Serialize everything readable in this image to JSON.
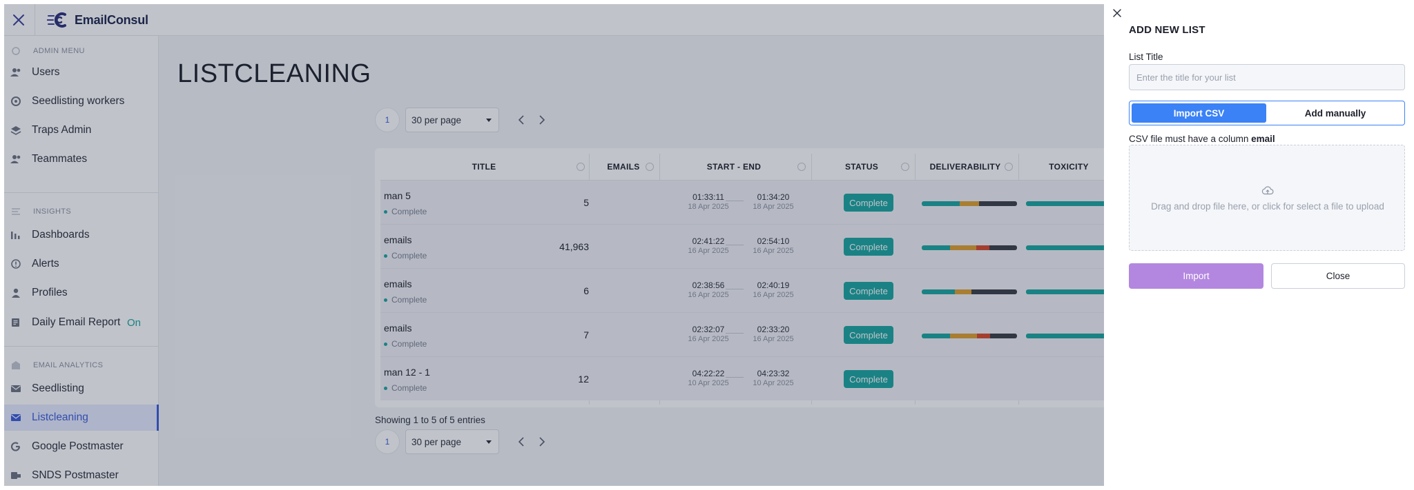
{
  "app": {
    "name": "EmailConsul"
  },
  "sidebar": {
    "sections": [
      {
        "heading": "ADMIN MENU",
        "icon": "shield-icon",
        "items": [
          {
            "label": "Users",
            "icon": "users-icon"
          },
          {
            "label": "Seedlisting workers",
            "icon": "worker-icon"
          },
          {
            "label": "Traps Admin",
            "icon": "layers-icon"
          },
          {
            "label": "Teammates",
            "icon": "team-icon"
          }
        ]
      },
      {
        "heading": "INSIGHTS",
        "icon": "list-icon",
        "items": [
          {
            "label": "Dashboards",
            "icon": "bar-chart-icon"
          },
          {
            "label": "Alerts",
            "icon": "alert-icon"
          },
          {
            "label": "Profiles",
            "icon": "person-icon"
          },
          {
            "label": "Daily Email Report",
            "icon": "report-icon",
            "extra": "On"
          }
        ]
      },
      {
        "heading": "EMAIL ANALYTICS",
        "icon": "building-icon",
        "items": [
          {
            "label": "Seedlisting",
            "icon": "envelope-icon"
          },
          {
            "label": "Listcleaning",
            "icon": "envelope-icon",
            "active": true
          },
          {
            "label": "Google Postmaster",
            "icon": "google-icon"
          },
          {
            "label": "SNDS Postmaster",
            "icon": "snds-icon"
          }
        ]
      }
    ]
  },
  "main": {
    "title": "LISTCLEANING",
    "pager": {
      "page": "1",
      "per_page": "30 per page"
    },
    "table": {
      "columns": [
        "TITLE",
        "EMAILS",
        "START - END",
        "STATUS",
        "DELIVERABILITY",
        "TOXICITY"
      ],
      "rows": [
        {
          "title": "man 5",
          "substatus": "Complete",
          "emails": "5",
          "start_time": "01:33:11",
          "start_date": "18 Apr 2025",
          "end_time": "01:34:20",
          "end_date": "18 Apr 2025",
          "status": "Complete",
          "deliverability": [
            {
              "pct": 40,
              "color": "#1aa5a0"
            },
            {
              "pct": 20,
              "color": "#e0a030"
            },
            {
              "pct": 40,
              "color": "#3a3d46"
            }
          ],
          "toxicity": true
        },
        {
          "title": "emails",
          "substatus": "Complete",
          "emails": "41,963",
          "start_time": "02:41:22",
          "start_date": "16 Apr 2025",
          "end_time": "02:54:10",
          "end_date": "16 Apr 2025",
          "status": "Complete",
          "deliverability": [
            {
              "pct": 30,
              "color": "#1aa5a0"
            },
            {
              "pct": 27,
              "color": "#e0a030"
            },
            {
              "pct": 14,
              "color": "#d9482b"
            },
            {
              "pct": 29,
              "color": "#3a3d46"
            }
          ],
          "toxicity": true
        },
        {
          "title": "emails",
          "substatus": "Complete",
          "emails": "6",
          "start_time": "02:38:56",
          "start_date": "16 Apr 2025",
          "end_time": "02:40:19",
          "end_date": "16 Apr 2025",
          "status": "Complete",
          "deliverability": [
            {
              "pct": 35,
              "color": "#1aa5a0"
            },
            {
              "pct": 17,
              "color": "#e0a030"
            },
            {
              "pct": 48,
              "color": "#3a3d46"
            }
          ],
          "toxicity": true
        },
        {
          "title": "emails",
          "substatus": "Complete",
          "emails": "7",
          "start_time": "02:32:07",
          "start_date": "16 Apr 2025",
          "end_time": "02:33:20",
          "end_date": "16 Apr 2025",
          "status": "Complete",
          "deliverability": [
            {
              "pct": 30,
              "color": "#1aa5a0"
            },
            {
              "pct": 28,
              "color": "#e0a030"
            },
            {
              "pct": 14,
              "color": "#d9482b"
            },
            {
              "pct": 28,
              "color": "#3a3d46"
            }
          ],
          "toxicity": true
        },
        {
          "title": "man 12 - 1",
          "substatus": "Complete",
          "emails": "12",
          "start_time": "04:22:22",
          "start_date": "10 Apr 2025",
          "end_time": "04:23:32",
          "end_date": "10 Apr 2025",
          "status": "Complete",
          "deliverability": [],
          "toxicity": false
        }
      ]
    },
    "showing": "Showing 1 to 5 of 5 entries"
  },
  "drawer": {
    "title": "ADD NEW LIST",
    "list_title_label": "List Title",
    "list_title_placeholder": "Enter the title for your list",
    "list_title_value": "",
    "tab_import": "Import CSV",
    "tab_manual": "Add manually",
    "csv_note_prefix": "CSV file must have a column ",
    "csv_note_column": "email",
    "dropzone_text": "Drag and drop file here, or click for select a file to upload",
    "import_button": "Import",
    "close_button": "Close"
  },
  "colors": {
    "accent": "#3b82f6",
    "active_nav": "#3b5bdb",
    "status_complete": "#1aa5a0",
    "import_button": "#b387e0"
  }
}
